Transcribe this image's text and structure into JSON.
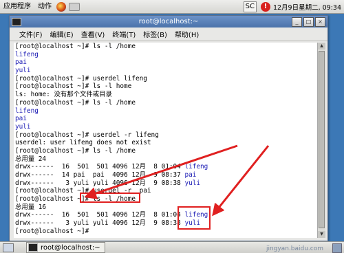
{
  "top_panel": {
    "apps_menu": "应用程序",
    "actions_menu": "动作",
    "sc_label": "SC",
    "alert_label": "!",
    "clock": "12月9日星期二, 09:34"
  },
  "window": {
    "title": "root@localhost:~",
    "controls": [
      "_",
      "□",
      "×"
    ],
    "menu": [
      "文件(F)",
      "编辑(E)",
      "查看(V)",
      "终端(T)",
      "标签(B)",
      "帮助(H)"
    ]
  },
  "terminal": {
    "lines": [
      {
        "text": "[root@localhost ~]# ls -l /home",
        "blue": false
      },
      {
        "text": "lifeng",
        "blue": true
      },
      {
        "text": "pai",
        "blue": true
      },
      {
        "text": "yuli",
        "blue": true
      },
      {
        "text": "[root@localhost ~]# userdel lifeng",
        "blue": false
      },
      {
        "text": "[root@localhost ~]# ls -l home",
        "blue": false
      },
      {
        "text": "ls: home: 没有那个文件或目录",
        "blue": false
      },
      {
        "text": "[root@localhost ~]# ls -l /home",
        "blue": false
      },
      {
        "text": "lifeng",
        "blue": true
      },
      {
        "text": "pai",
        "blue": true
      },
      {
        "text": "yuli",
        "blue": true
      },
      {
        "text": "[root@localhost ~]# userdel -r lifeng",
        "blue": false
      },
      {
        "text": "userdel: user lifeng does not exist",
        "blue": false
      },
      {
        "text": "[root@localhost ~]# ls -l /home",
        "blue": false
      },
      {
        "text": "总用量 24",
        "blue": false
      },
      {
        "text": "drwx------  16  501  501 4096 12月  8 01:04 lifeng",
        "blue": false
      },
      {
        "text": "drwx------  14 pai  pai  4096 12月  9 08:37 pai",
        "blue": false
      },
      {
        "text": "drwx------   3 yuli yuli 4096 12月  9 08:38 yuli",
        "blue": false
      },
      {
        "text": "[root@localhost ~]# userdel -r  pai",
        "blue": false
      },
      {
        "text": "[root@localhost ~]# ls -l /home",
        "blue": false
      },
      {
        "text": "总用量 16",
        "blue": false
      },
      {
        "text": "drwx------  16  501  501 4096 12月  8 01:04 lifeng",
        "blue": false
      },
      {
        "text": "drwx------   3 yuli yuli 4096 12月  9 08:38 yuli",
        "blue": false
      },
      {
        "text": "[root@localhost ~]# ",
        "blue": false
      }
    ]
  },
  "bottom_panel": {
    "task_label": "root@localhost:~",
    "watermark": "jingyan.baidu.com"
  },
  "annotation_color": "#e02020"
}
